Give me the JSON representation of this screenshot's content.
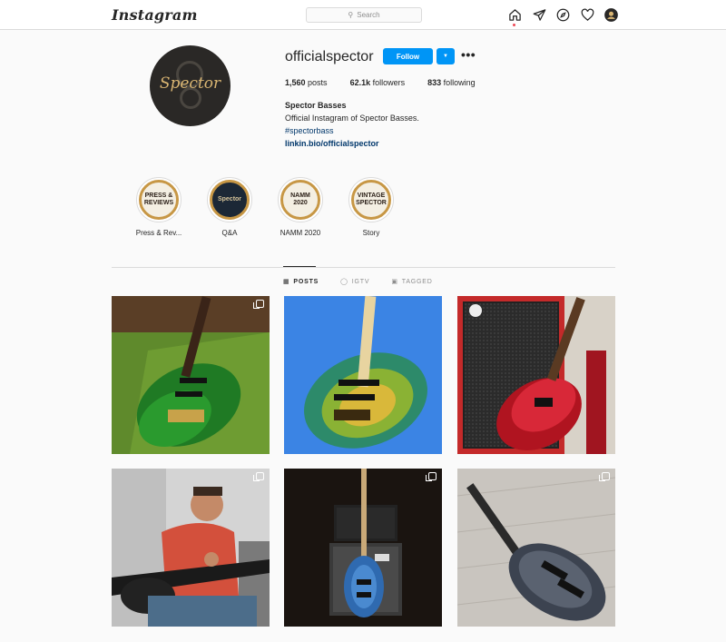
{
  "nav": {
    "logo": "Instagram",
    "search_placeholder": "Search",
    "icons": [
      "home-icon",
      "direct-icon",
      "explore-icon",
      "activity-icon",
      "profile-avatar-icon"
    ]
  },
  "profile": {
    "avatar_text": "Spector",
    "username": "officialspector",
    "follow_label": "Follow",
    "posts_count": "1,560",
    "posts_label": "posts",
    "followers_count": "62.1k",
    "followers_label": "followers",
    "following_count": "833",
    "following_label": "following",
    "full_name": "Spector Basses",
    "bio": "Official Instagram of Spector Basses.",
    "hashtag": "#spectorbass",
    "link": "linkin.bio/officialspector"
  },
  "highlights": [
    {
      "label": "Press & Rev...",
      "cover_text": "PRESS & REVIEWS"
    },
    {
      "label": "Q&A",
      "cover_text": "Spector"
    },
    {
      "label": "NAMM 2020",
      "cover_text": "NAMM 2020"
    },
    {
      "label": "Story",
      "cover_text": "VINTAGE SPECTOR"
    }
  ],
  "tabs": [
    {
      "label": "POSTS",
      "icon": "grid-icon",
      "active": true
    },
    {
      "label": "IGTV",
      "icon": "igtv-icon",
      "active": false
    },
    {
      "label": "TAGGED",
      "icon": "tagged-icon",
      "active": false
    }
  ],
  "posts": [
    {
      "description": "Green bass guitar on green mat",
      "multi": true,
      "colors": [
        "#6a4a2e",
        "#2f8a2a"
      ]
    },
    {
      "description": "Blue and yellow burst bass guitar",
      "multi": false,
      "colors": [
        "#3b86e6",
        "#7fae3a"
      ]
    },
    {
      "description": "Red bass guitar in front of red amplifier",
      "multi": false,
      "colors": [
        "#c0202c",
        "#2a2a2a"
      ]
    },
    {
      "description": "Man in red shirt playing bass",
      "multi": true,
      "colors": [
        "#d6d6d6",
        "#c64a3a"
      ]
    },
    {
      "description": "Blue bass guitar in front of amplifier stack",
      "multi": true,
      "colors": [
        "#1a1410",
        "#2f6ab0"
      ]
    },
    {
      "description": "Grey bass guitar on wooden floor",
      "multi": true,
      "colors": [
        "#c7c3bd",
        "#4a5058"
      ]
    }
  ]
}
